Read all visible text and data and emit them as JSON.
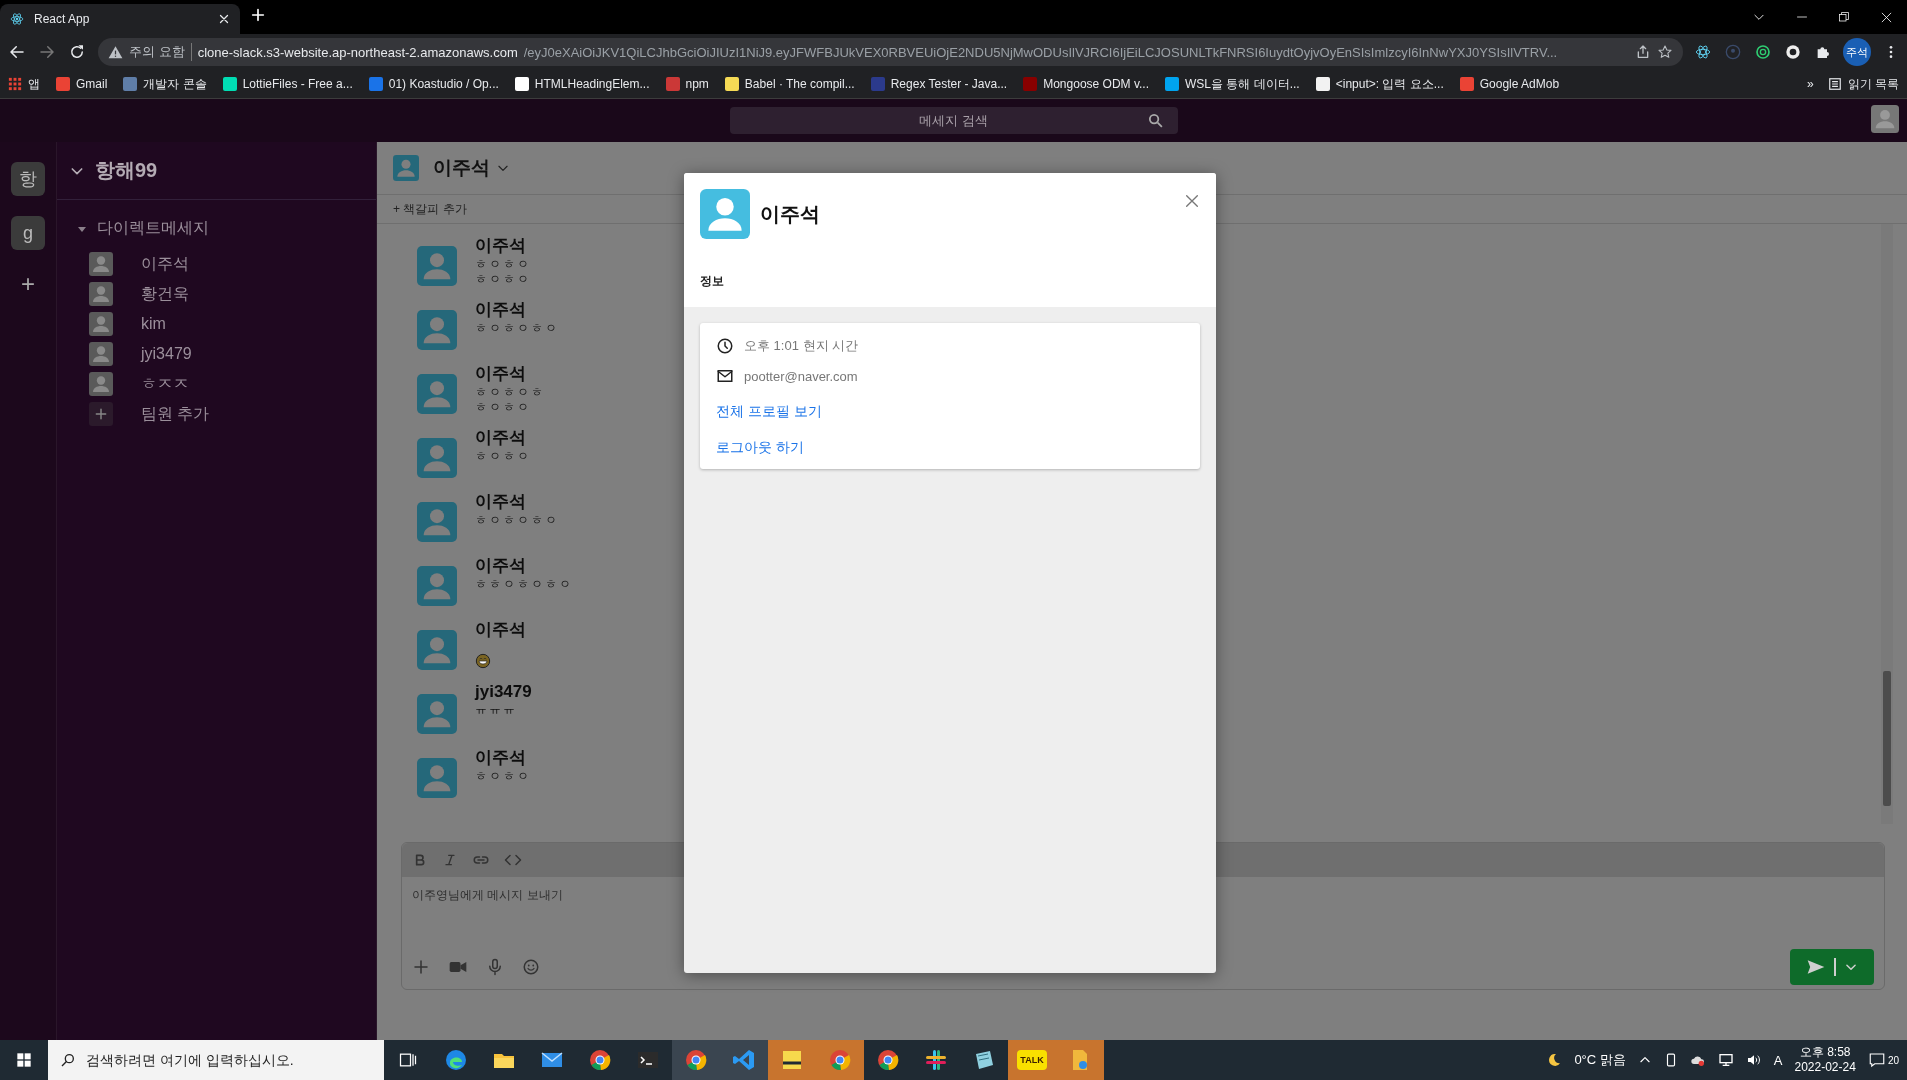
{
  "browser": {
    "tab": {
      "title": "React App"
    },
    "security_label": "주의 요함",
    "url_host": "clone-slack.s3-website.ap-northeast-2.amazonaws.com",
    "url_path": "/eyJ0eXAiOiJKV1QiLCJhbGciOiJIUzI1NiJ9.eyJFWFBJUkVEX0RBVEUiOjE2NDU5NjMwODUsIlVJRCI6IjEiLCJOSUNLTkFNRSI6IuydtOyjvOyEnSIsImlzcyI6InNwYXJ0YSIsIlVTRV...",
    "profile": "주석",
    "apps_label": "앱",
    "bookmarks": [
      {
        "label": "Gmail",
        "color": "#ea4335"
      },
      {
        "label": "개발자 콘솔",
        "color": "#5f7ea8"
      },
      {
        "label": "LottieFiles - Free a...",
        "color": "#00ddb3"
      },
      {
        "label": "01) Koastudio / Op...",
        "color": "#1a73e8"
      },
      {
        "label": "HTMLHeadingElem...",
        "color": "#ffffff"
      },
      {
        "label": "npm",
        "color": "#cb3837"
      },
      {
        "label": "Babel · The compil...",
        "color": "#f5da55"
      },
      {
        "label": "Regex Tester - Java...",
        "color": "#2b3a8c"
      },
      {
        "label": "Mongoose ODM v...",
        "color": "#880000"
      },
      {
        "label": "WSL을 통해 데이터...",
        "color": "#00a4ef"
      },
      {
        "label": "<input>: 입력 요소...",
        "color": "#f2f2f2"
      },
      {
        "label": "Google AdMob",
        "color": "#ea4335"
      }
    ],
    "more": "»",
    "reading_list": "읽기 목록"
  },
  "app": {
    "search": {
      "placeholder": "메세지 검색"
    },
    "workspaces": [
      {
        "label": "항"
      },
      {
        "label": "g"
      }
    ],
    "add_workspace": "+",
    "workspace_title": "항해99",
    "section": {
      "label": "다이렉트메세지",
      "expanded": true
    },
    "members": [
      {
        "name": "이주석"
      },
      {
        "name": "황건욱"
      },
      {
        "name": "kim"
      },
      {
        "name": "jyi3479"
      },
      {
        "name": "ㅎㅈㅈ"
      }
    ],
    "add_member": "팀원 추가",
    "channel": {
      "name": "이주석"
    },
    "bookmark_add": "+ 책갈피 추가",
    "messages": [
      {
        "author": "이주석",
        "kind": "text",
        "lines": [
          "ㅎㅇㅎㅇ",
          "ㅎㅇㅎㅇ"
        ]
      },
      {
        "author": "이주석",
        "kind": "text",
        "lines": [
          "ㅎㅇㅎㅇㅎㅇ"
        ]
      },
      {
        "author": "이주석",
        "kind": "text",
        "lines": [
          "ㅎㅇㅎㅇㅎ",
          "ㅎㅇㅎㅇ"
        ]
      },
      {
        "author": "이주석",
        "kind": "text",
        "lines": [
          "ㅎㅇㅎㅇ"
        ]
      },
      {
        "author": "이주석",
        "kind": "text",
        "lines": [
          "ㅎㅇㅎㅇㅎㅇ"
        ]
      },
      {
        "author": "이주석",
        "kind": "text",
        "lines": [
          "ㅎㅎㅇㅎㅇㅎㅇ"
        ]
      },
      {
        "author": "이주석",
        "kind": "emoji"
      },
      {
        "author": "jyi3479",
        "kind": "text",
        "lines": [
          "ㅠㅠㅠ"
        ]
      },
      {
        "author": "이주석",
        "kind": "text",
        "lines": [
          "ㅎㅇㅎㅇ"
        ]
      }
    ],
    "composer": {
      "placeholder": "이주영님에게 메시지 보내기"
    },
    "profile_modal": {
      "name": "이주석",
      "section": "정보",
      "local_time": "오후 1:01 현지 시간",
      "email": "pootter@naver.com",
      "links": [
        "전체 프로필 보기",
        "로그아웃 하기"
      ]
    }
  },
  "taskbar": {
    "search": {
      "placeholder": "검색하려면 여기에 입력하십시오."
    },
    "apps": [
      {
        "kind": "taskview",
        "flashing": false
      },
      {
        "kind": "edge",
        "flashing": false
      },
      {
        "kind": "folder",
        "flashing": false
      },
      {
        "kind": "mail",
        "flashing": false
      },
      {
        "kind": "chrome",
        "flashing": false
      },
      {
        "kind": "terminal",
        "flashing": false
      },
      {
        "kind": "chrome",
        "flashing": false,
        "active": true
      },
      {
        "kind": "code",
        "flashing": false,
        "active": true
      },
      {
        "kind": "note",
        "flashing": true
      },
      {
        "kind": "chrome",
        "flashing": true
      },
      {
        "kind": "chrome",
        "flashing": false
      },
      {
        "kind": "slack",
        "flashing": false
      },
      {
        "kind": "glass",
        "flashing": false
      },
      {
        "kind": "talk",
        "flashing": true,
        "badge": "TALK"
      },
      {
        "kind": "file",
        "flashing": true
      }
    ],
    "weather": "0°C 맑음",
    "ime": "A",
    "time": "오후 8:58",
    "date": "2022-02-24",
    "notifications": "20"
  }
}
